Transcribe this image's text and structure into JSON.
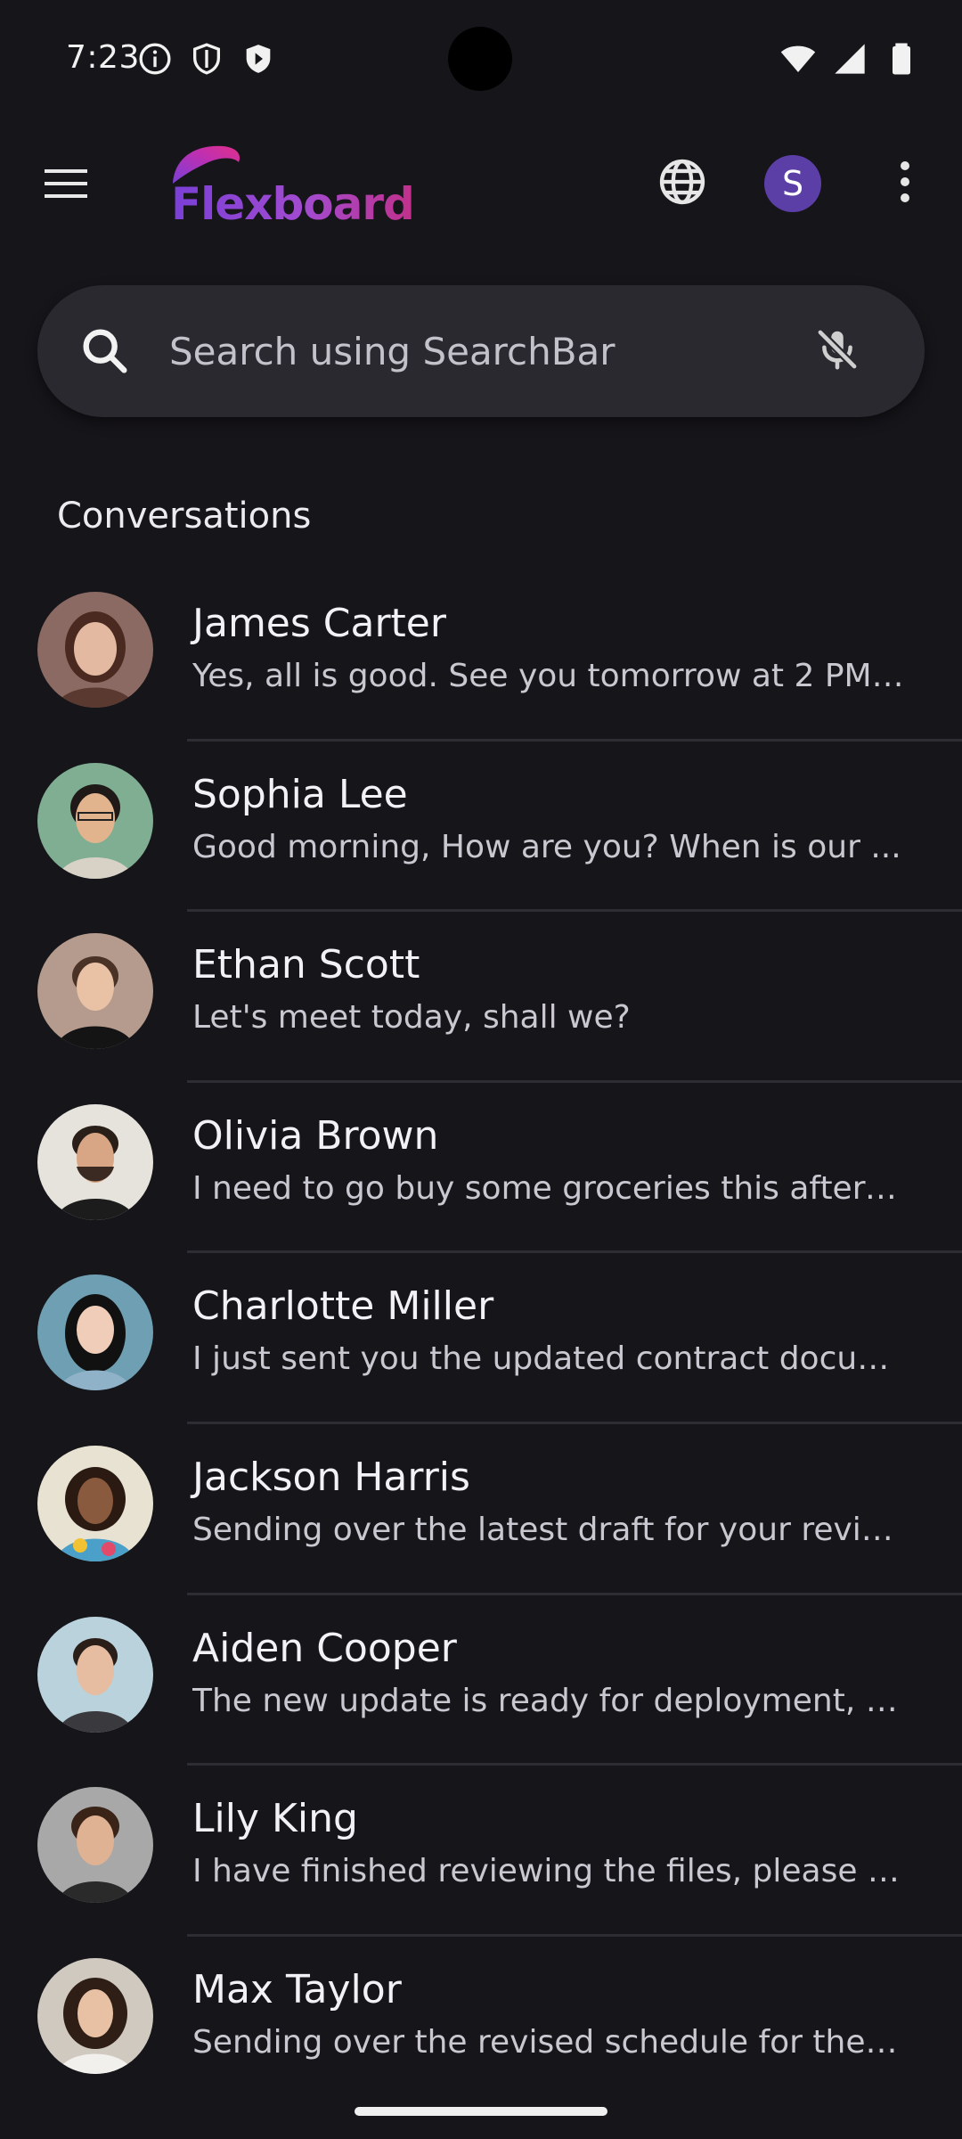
{
  "status_bar": {
    "time": "7:23",
    "left_icons": [
      "info-icon",
      "shield-outline-icon",
      "shield-filled-icon"
    ],
    "right_icons": [
      "wifi-icon",
      "signal-icon",
      "battery-icon"
    ]
  },
  "app_bar": {
    "logo_text": "Flexboard",
    "avatar_letter": "S",
    "avatar_color": "#5b3fa7",
    "icons": [
      "menu-icon",
      "globe-icon",
      "more-vert-icon"
    ]
  },
  "search": {
    "placeholder": "Search using SearchBar",
    "value": ""
  },
  "section_title": "Conversations",
  "conversations": [
    {
      "name": "James Carter",
      "message": "Yes, all is good. See you tomorrow at 2 PM ..."
    },
    {
      "name": "Sophia Lee",
      "message": "Good morning, How are you? When is our ..."
    },
    {
      "name": "Ethan Scott",
      "message": "Let's meet today, shall we?"
    },
    {
      "name": "Olivia Brown",
      "message": "I need to go buy some groceries this aftern..."
    },
    {
      "name": "Charlotte Miller",
      "message": "I just sent you the updated contract docum..."
    },
    {
      "name": "Jackson Harris",
      "message": "Sending over the latest draft for your review"
    },
    {
      "name": "Aiden Cooper",
      "message": "The new update is ready for deployment, p..."
    },
    {
      "name": "Lily King",
      "message": "I have finished reviewing the files, please t..."
    },
    {
      "name": "Max Taylor",
      "message": "Sending over the revised schedule for the ..."
    }
  ],
  "colors": {
    "background": "#16151a",
    "search_bg": "#2a292f",
    "divider": "#2e2d33",
    "logo_gradient": [
      "#7a3fd6",
      "#c2308a"
    ]
  }
}
